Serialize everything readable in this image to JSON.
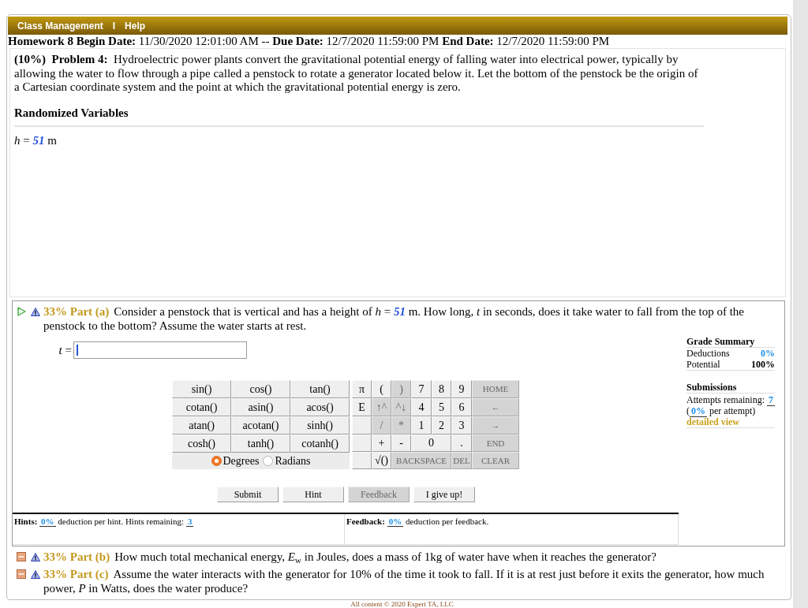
{
  "nav": {
    "links": [
      "Class Management",
      "Help"
    ],
    "separator": "I"
  },
  "assignment": "**Homework 8 Begin Date:** 11/30/2020 12:01:00 AM -- **Due Date:** 12/7/2020 11:59:00 PM **End Date:** 12/7/2020 11:59:00 PM",
  "problem": {
    "statement": "**(10%)  Problem 4:**  Hydroelectric power plants convert the gravitational potential energy of falling water into electrical power, typically by allowing the water to flow through a pipe called a penstock to rotate a generator located below it. Let the bottom of the penstock be the origin of a Cartesian coordinate system and the point at which the gravitational potential energy is zero.",
    "variables_heading": "Randomized Variables",
    "variables": [
      {
        "symbol": "h",
        "operator": "=",
        "value": "51",
        "unit": "m"
      }
    ]
  },
  "parts": [
    {
      "label": "33% Part (a)",
      "expanded": true,
      "question": [
        {
          "kind": "text",
          "text": "Consider a penstock that is vertical and has a height of "
        },
        {
          "kind": "symbol",
          "text": "h"
        },
        {
          "kind": "text",
          "text": " = "
        },
        {
          "kind": "value",
          "text": "51"
        },
        {
          "kind": "text",
          "text": " m. How long, "
        },
        {
          "kind": "symbol",
          "text": "t"
        },
        {
          "kind": "text",
          "text": " in seconds, does it take water to fall from the top of the penstock to the bottom? Assume the water starts at rest."
        }
      ],
      "workspace": {
        "answer": {
          "symbol": "t",
          "operator": "="
        },
        "grade_summary": {
          "heading": "Grade Summary",
          "rows": [
            {
              "kind": "highlight",
              "label": "Deductions",
              "value": "0%"
            },
            {
              "kind": "total",
              "label": "Potential",
              "value": "100%"
            }
          ]
        },
        "submissions": {
          "heading": "Submissions",
          "attempts": [
            {
              "kind": "text",
              "text": "Attempts remaining: "
            },
            {
              "kind": "link-value",
              "text": "7"
            }
          ],
          "penalty": [
            {
              "kind": "text",
              "text": "("
            },
            {
              "kind": "link-value",
              "text": "0%"
            },
            {
              "kind": "text",
              "text": " per attempt)"
            }
          ],
          "details_link": "detailed view"
        },
        "calculator": {
          "functions": [
            [
              "sin()",
              "cos()",
              "tan()"
            ],
            [
              "cotan()",
              "asin()",
              "acos()"
            ],
            [
              "atan()",
              "acotan()",
              "sinh()"
            ],
            [
              "cosh()",
              "tanh()",
              "cotanh()"
            ]
          ],
          "angle_modes": [
            {
              "label": "Degrees",
              "selected": true
            },
            {
              "label": "Radians",
              "selected": false
            }
          ],
          "keypad": [
            {
              "constant": "π",
              "keys": [
                {
                  "label": "(",
                  "kind": "key",
                  "disabled": false
                },
                {
                  "label": ")",
                  "kind": "key",
                  "disabled": true
                },
                {
                  "label": "7",
                  "kind": "key",
                  "disabled": false
                },
                {
                  "label": "8",
                  "kind": "key",
                  "disabled": false
                },
                {
                  "label": "9",
                  "kind": "key",
                  "disabled": false
                },
                {
                  "label": "HOME",
                  "kind": "control",
                  "disabled": true
                }
              ]
            },
            {
              "constant": "E",
              "keys": [
                {
                  "label": "↑^",
                  "kind": "key",
                  "disabled": true
                },
                {
                  "label": "^↓",
                  "kind": "key",
                  "disabled": true
                },
                {
                  "label": "4",
                  "kind": "key",
                  "disabled": false
                },
                {
                  "label": "5",
                  "kind": "key",
                  "disabled": false
                },
                {
                  "label": "6",
                  "kind": "key",
                  "disabled": false
                },
                {
                  "label": "←",
                  "kind": "control",
                  "disabled": true
                }
              ]
            },
            {
              "keys": [
                {
                  "label": "/",
                  "kind": "key",
                  "disabled": true
                },
                {
                  "label": "*",
                  "kind": "key",
                  "disabled": true
                },
                {
                  "label": "1",
                  "kind": "key",
                  "disabled": false
                },
                {
                  "label": "2",
                  "kind": "key",
                  "disabled": false
                },
                {
                  "label": "3",
                  "kind": "key",
                  "disabled": false
                },
                {
                  "label": "→",
                  "kind": "control",
                  "disabled": true
                }
              ]
            },
            {
              "keys": [
                {
                  "label": "+",
                  "kind": "key",
                  "disabled": false
                },
                {
                  "label": "-",
                  "kind": "key",
                  "disabled": false
                },
                {
                  "label": "0",
                  "kind": "wide",
                  "disabled": false
                },
                {
                  "label": ".",
                  "kind": "key",
                  "disabled": false
                },
                {
                  "label": "END",
                  "kind": "control",
                  "disabled": true
                }
              ]
            },
            {
              "keys": [
                {
                  "label": "√()",
                  "kind": "key",
                  "disabled": false
                },
                {
                  "label": "BACKSPACE",
                  "kind": "wide-control",
                  "disabled": true
                },
                {
                  "label": "DEL",
                  "kind": "control",
                  "disabled": true
                },
                {
                  "label": "CLEAR",
                  "kind": "control",
                  "disabled": true
                }
              ]
            }
          ]
        },
        "actions": [
          {
            "label": "Submit",
            "disabled": false
          },
          {
            "label": "Hint",
            "disabled": false
          },
          {
            "label": "Feedback",
            "disabled": true
          },
          {
            "label": "I give up!",
            "disabled": false
          }
        ],
        "hints": [
          {
            "kind": "label",
            "text": "Hints: "
          },
          {
            "kind": "link-value",
            "text": "0%"
          },
          {
            "kind": "text",
            "text": " deduction per hint. Hints remaining: "
          },
          {
            "kind": "link-value",
            "text": "3"
          }
        ],
        "feedback": [
          {
            "kind": "label",
            "text": "Feedback: "
          },
          {
            "kind": "link-value",
            "text": "0%"
          },
          {
            "kind": "text",
            "text": " deduction per feedback."
          }
        ]
      }
    },
    {
      "label": "33% Part (b)",
      "expanded": false,
      "question": [
        {
          "kind": "text",
          "text": "How much total mechanical energy, "
        },
        {
          "kind": "symbol",
          "text": "E"
        },
        {
          "kind": "subscript",
          "text": "w"
        },
        {
          "kind": "text",
          "text": " in Joules, does a mass of 1kg of water have when it reaches the generator?"
        }
      ]
    },
    {
      "label": "33% Part (c)",
      "expanded": false,
      "question": [
        {
          "kind": "text",
          "text": "Assume the water interacts with the generator for 10% of the time it took to fall. If it is at rest just before it exits the generator, how much power, "
        },
        {
          "kind": "symbol",
          "text": "P"
        },
        {
          "kind": "text",
          "text": " in Watts, does the water produce?"
        }
      ]
    }
  ],
  "footer": "All content © 2020 Expert TA, LLC"
}
